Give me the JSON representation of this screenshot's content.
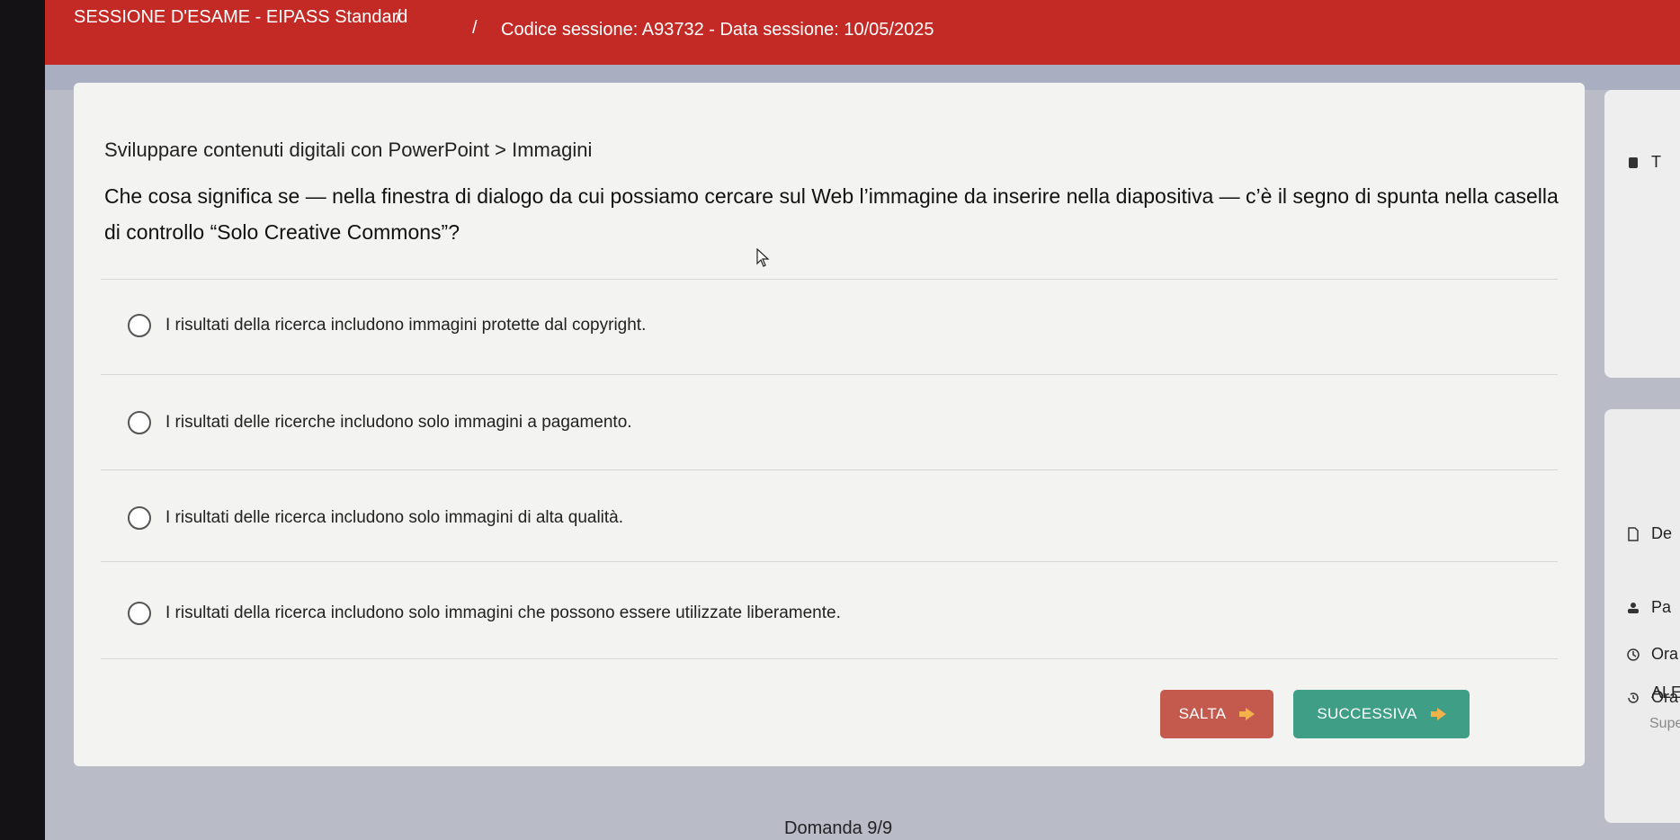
{
  "header": {
    "title": "SESSIONE D'ESAME - EIPASS Standard",
    "separator": "/",
    "session_info": "Codice sessione: A93732 - Data sessione: 10/05/2025"
  },
  "question": {
    "breadcrumb": "Sviluppare contenuti digitali con PowerPoint > Immagini",
    "text": "Che cosa significa se — nella finestra di dialogo da cui possiamo cercare sul Web l’immagine da inserire nella diapositiva — c’è il segno di spunta nella casella di controllo “Solo Creative Commons”?",
    "options": [
      "I risultati della ricerca includono immagini protette dal copyright.",
      "I risultati delle ricerche includono solo immagini a pagamento.",
      "I risultati delle ricerca includono solo immagini di alta qualità.",
      "I risultati della ricerca includono solo immagini che possono essere utilizzate liberamente."
    ]
  },
  "buttons": {
    "skip": "SALTA",
    "next": "SUCCESSIVA"
  },
  "footer": {
    "counter": "Domanda 9/9"
  },
  "sidebar": {
    "top_label": "T",
    "items": [
      {
        "label": "De",
        "icon": "document-icon"
      },
      {
        "label": "Pa",
        "icon": "person-icon"
      },
      {
        "label": "Ora",
        "icon": "clock-icon"
      },
      {
        "label": "Ora",
        "icon": "history-icon"
      }
    ],
    "user_title": "ALES",
    "user_sub": "Supe"
  },
  "colors": {
    "header": "#c42a25",
    "skip_button": "#c45a4e",
    "next_button": "#3e9e86"
  }
}
